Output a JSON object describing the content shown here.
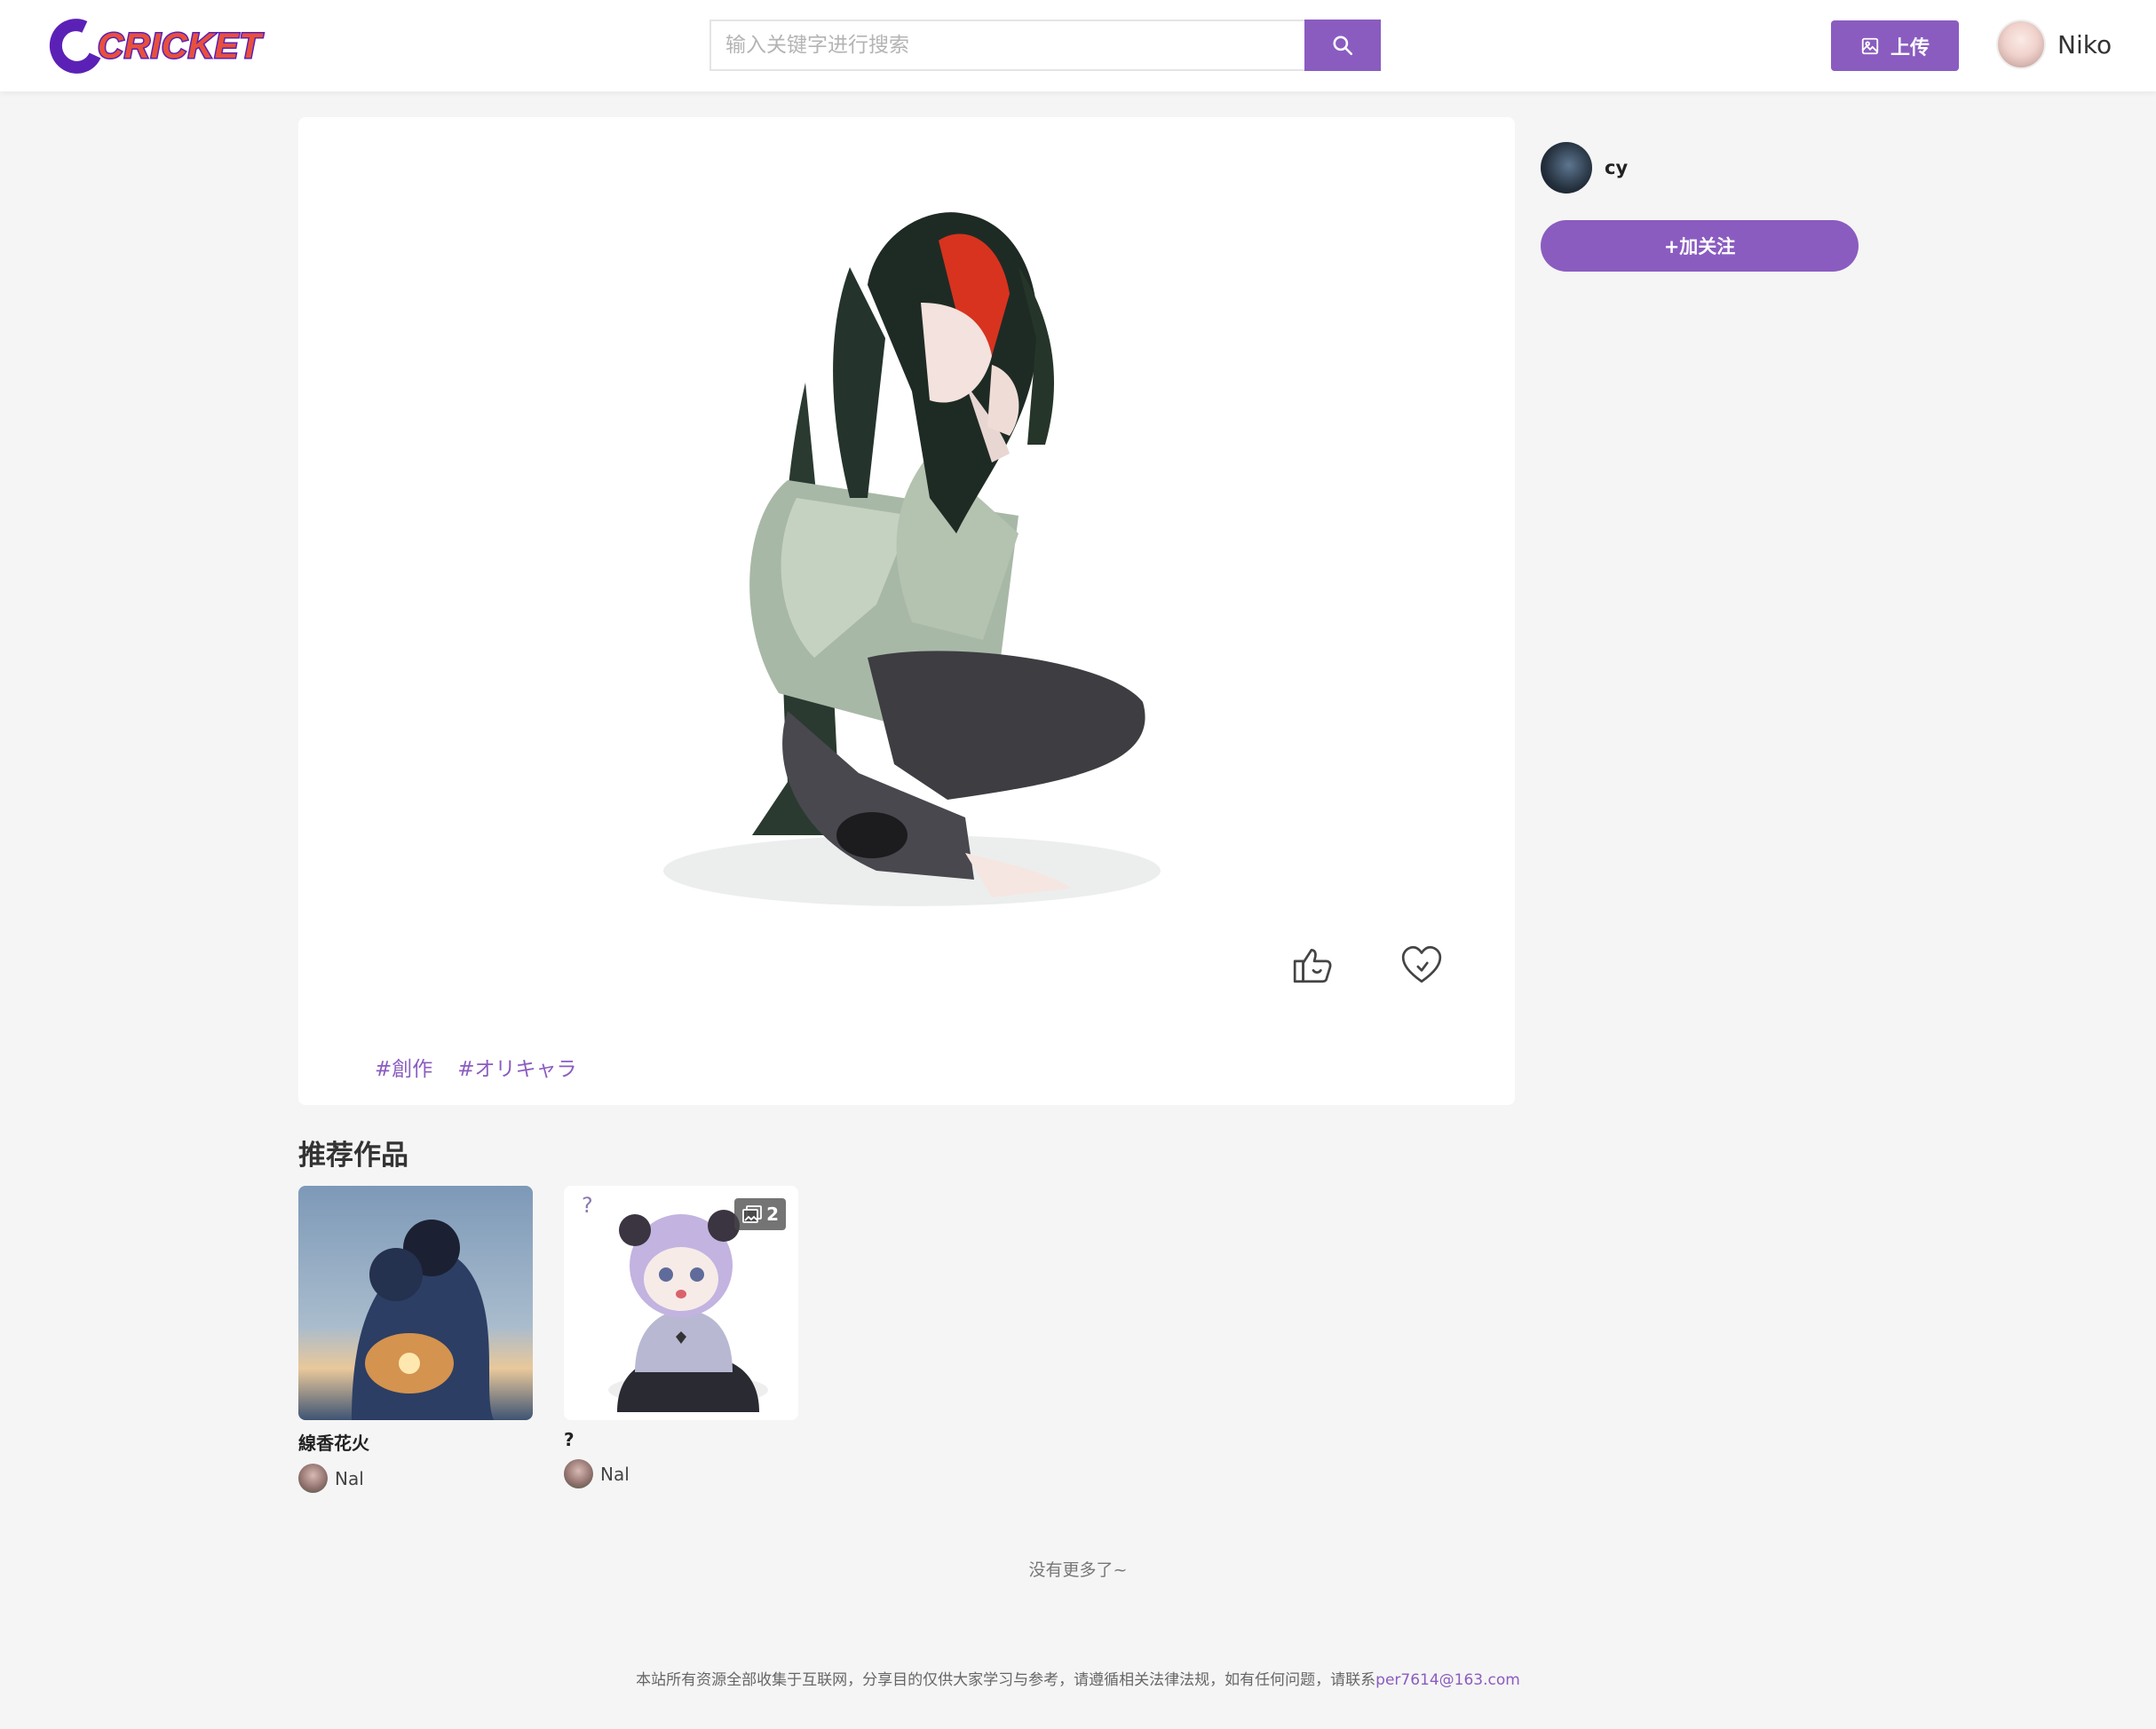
{
  "header": {
    "logo_text": "CRICKET",
    "search_placeholder": "输入关键字进行搜索",
    "upload_label": "上传",
    "user_name": "Niko"
  },
  "artwork": {
    "tags": [
      "#創作",
      "#オリキャラ"
    ]
  },
  "author": {
    "name": "cy",
    "follow_label": "+加关注"
  },
  "recommended": {
    "title": "推荐作品",
    "items": [
      {
        "name": "線香花火",
        "author": "Nal"
      },
      {
        "name": "?",
        "author": "Nal",
        "image_count": "2"
      }
    ]
  },
  "no_more": "没有更多了~",
  "footer": {
    "text": "本站所有资源全部收集于互联网，分享目的仅供大家学习与参考，请遵循相关法律法规，如有任何问题，请联系",
    "email": "per7614@163.com"
  },
  "colors": {
    "accent": "#8a5cc0",
    "background": "#f5f5f5",
    "logo_red": "#e8503c",
    "logo_purple": "#5b21b6"
  },
  "icons": [
    "search-icon",
    "image-icon",
    "like-icon",
    "favorite-icon",
    "multi-image-icon"
  ]
}
